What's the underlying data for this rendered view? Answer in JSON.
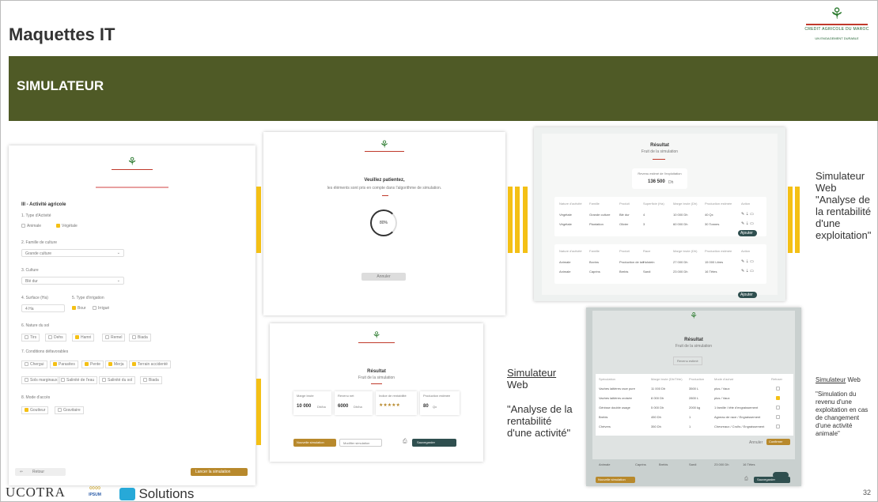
{
  "slide_title": "Maquettes IT",
  "section_title": "SIMULATEUR",
  "logo": {
    "line1": "CREDIT AGRICOLE DU MAROC",
    "line2": "UN ENGAGEMENT DURABLE"
  },
  "form": {
    "heading": "III - Activité agricole",
    "q1": "1. Type d'Activité",
    "opt_animale": "Animale",
    "opt_vegetale": "Végétale",
    "q2": "2. Famille de culture",
    "famille_value": "Grande culture",
    "q3": "3. Culture",
    "culture_value": "Blé dur",
    "q4": "4. Surface (Ha)",
    "surface_value": "4 Ha",
    "q5": "5. Type d'irrigation",
    "irr1": "Bour",
    "irr2": "Irrigué",
    "q6": "6. Nature du sol",
    "sols": [
      "Tirs",
      "Dehs",
      "Hamri",
      "Remel",
      "Biada"
    ],
    "q7": "7. Conditions défavorables",
    "conds": [
      "Chergui",
      "Parasites",
      "Pente",
      "Merja",
      "Terrain accidenté"
    ],
    "conds2": [
      "Sols marginaux",
      "Salinité de l'eau",
      "Salinité du sol",
      "Biada"
    ],
    "q8": "8. Mode d'accès",
    "acc1": "Goutteur",
    "acc2": "Gravitaire",
    "back": "Retour",
    "submit": "Lancer la simulation"
  },
  "wait": {
    "title": "Veuillez patientez,",
    "sub": "les éléments sont pris en compte dans l'algorithme de simulation.",
    "progress": "80%",
    "btn": "Annuler"
  },
  "result_table": {
    "title": "Résultat",
    "sub": "Fruit de la simulation",
    "box_label": "Revenu estimé de l'exploitation",
    "amount": "136 500",
    "currency": "Dh",
    "btn": "Ajouter",
    "h1": [
      "Nature d'activité",
      "Famille",
      "Produit",
      "Superficie (Ha)",
      "Marge brute (Dh)",
      "Production estimée",
      "Action"
    ],
    "r1": [
      "Végétale",
      "Grande culture",
      "Blé dur",
      "4",
      "10 000 Dh",
      "40 Qx"
    ],
    "r2": [
      "Végétale",
      "Plantation",
      "Olivier",
      "3",
      "60 000 Dh",
      "30 Tonnes"
    ],
    "h2": [
      "Nature d'activité",
      "Famille",
      "Produit",
      "Race",
      "Marge brute (Dh)",
      "Production estimée",
      "Action"
    ],
    "r3": [
      "Animale",
      "Bovins",
      "Production de lait",
      "Holstein",
      "27 000 Dh",
      "15 000 Litres"
    ],
    "r4": [
      "Animale",
      "Caprins",
      "Brebis",
      "Sardi",
      "23 000 Dh",
      "16 Têtes"
    ]
  },
  "label1": {
    "a": "Simulateur",
    "b": "Web",
    "c": "\"Analyse de",
    "d": "la rentabilité",
    "e": "d'une",
    "f": "exploitation\""
  },
  "result_cards": {
    "title": "Résultat",
    "sub": "Fruit de la simulation",
    "c1_label": "Marge brute",
    "c1_value": "10 000",
    "c1_unit": "Dh/ha",
    "c2_label": "Revenu net",
    "c2_value": "6000",
    "c2_unit": "Dh/ha",
    "c3_label": "Indice de rentabilité",
    "c3_value": "★★★★★",
    "c4_label": "Production estimée",
    "c4_value": "80",
    "c4_unit": "Qx",
    "b1": "Nouvelle simulation",
    "b2": "Modifier simulation",
    "b3": "Sauvegarder"
  },
  "label2": {
    "a": "Simulateur",
    "b": "Web",
    "c": "\"Analyse de la",
    "d": "rentabilité",
    "e": "d'une activité\""
  },
  "animal_table": {
    "title": "Résultat",
    "sub": "Fruit de la simulation",
    "box": "Revenu estimé",
    "heads": [
      "Spéculation",
      "Marge brute (Dh/Tête)",
      "Production",
      "Mode d'achat",
      "Refuser"
    ],
    "rows": [
      [
        "Vaches laitières race pure",
        "11 000 Dh",
        "3500 L",
        "plus / Vaux"
      ],
      [
        "Vaches laitières croisée",
        "8 000 Dh",
        "2800 L",
        "plus / Vaux"
      ],
      [
        "Génisse double usage",
        "5 000 Dh",
        "2000 kg",
        "1 famille / tête d'engraissement"
      ],
      [
        "Brebis",
        "450 Dh",
        "1",
        "Agneau de race / Engraissement"
      ],
      [
        "Chèvres",
        "350 Dh",
        "1",
        "Chevreaux / Croîts / Engraissement"
      ]
    ],
    "bot": [
      "Animale",
      "Caprins",
      "Brebis",
      "Sardi",
      "23 000 Dh",
      "16 Têtes"
    ],
    "btn_cancel": "Annuler",
    "btn_ok": "Confirmer",
    "b_left": "Nouvelle simulation",
    "b_right": "Sauvegarder"
  },
  "label3": {
    "a": "Simulateur",
    "a2": "Web",
    "b": "\"Simulation du",
    "c": "revenu d'une",
    "d": "exploitation en cas",
    "e": "de changement",
    "f": "d'une activité",
    "g": "animale\""
  },
  "footer": {
    "ucotra": "UCOTRA",
    "ucotra_sub": "CONSULTING",
    "ipsum": "IPSUM",
    "solutions": "Solutions",
    "page": "32"
  }
}
